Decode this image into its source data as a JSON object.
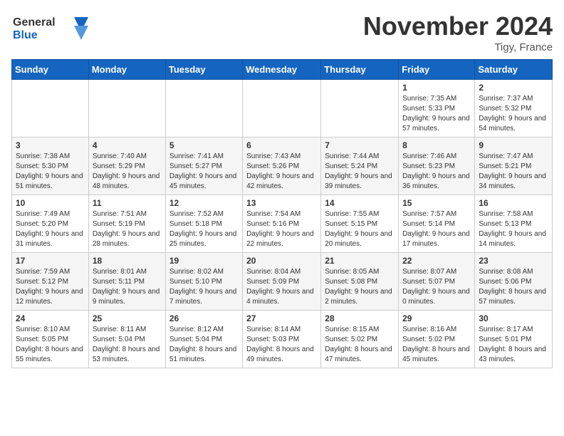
{
  "header": {
    "logo_line1": "General",
    "logo_line2": "Blue",
    "month_title": "November 2024",
    "location": "Tigy, France"
  },
  "weekdays": [
    "Sunday",
    "Monday",
    "Tuesday",
    "Wednesday",
    "Thursday",
    "Friday",
    "Saturday"
  ],
  "weeks": [
    [
      {
        "day": "",
        "info": ""
      },
      {
        "day": "",
        "info": ""
      },
      {
        "day": "",
        "info": ""
      },
      {
        "day": "",
        "info": ""
      },
      {
        "day": "",
        "info": ""
      },
      {
        "day": "1",
        "info": "Sunrise: 7:35 AM\nSunset: 5:33 PM\nDaylight: 9 hours and 57 minutes."
      },
      {
        "day": "2",
        "info": "Sunrise: 7:37 AM\nSunset: 5:32 PM\nDaylight: 9 hours and 54 minutes."
      }
    ],
    [
      {
        "day": "3",
        "info": "Sunrise: 7:38 AM\nSunset: 5:30 PM\nDaylight: 9 hours and 51 minutes."
      },
      {
        "day": "4",
        "info": "Sunrise: 7:40 AM\nSunset: 5:29 PM\nDaylight: 9 hours and 48 minutes."
      },
      {
        "day": "5",
        "info": "Sunrise: 7:41 AM\nSunset: 5:27 PM\nDaylight: 9 hours and 45 minutes."
      },
      {
        "day": "6",
        "info": "Sunrise: 7:43 AM\nSunset: 5:26 PM\nDaylight: 9 hours and 42 minutes."
      },
      {
        "day": "7",
        "info": "Sunrise: 7:44 AM\nSunset: 5:24 PM\nDaylight: 9 hours and 39 minutes."
      },
      {
        "day": "8",
        "info": "Sunrise: 7:46 AM\nSunset: 5:23 PM\nDaylight: 9 hours and 36 minutes."
      },
      {
        "day": "9",
        "info": "Sunrise: 7:47 AM\nSunset: 5:21 PM\nDaylight: 9 hours and 34 minutes."
      }
    ],
    [
      {
        "day": "10",
        "info": "Sunrise: 7:49 AM\nSunset: 5:20 PM\nDaylight: 9 hours and 31 minutes."
      },
      {
        "day": "11",
        "info": "Sunrise: 7:51 AM\nSunset: 5:19 PM\nDaylight: 9 hours and 28 minutes."
      },
      {
        "day": "12",
        "info": "Sunrise: 7:52 AM\nSunset: 5:18 PM\nDaylight: 9 hours and 25 minutes."
      },
      {
        "day": "13",
        "info": "Sunrise: 7:54 AM\nSunset: 5:16 PM\nDaylight: 9 hours and 22 minutes."
      },
      {
        "day": "14",
        "info": "Sunrise: 7:55 AM\nSunset: 5:15 PM\nDaylight: 9 hours and 20 minutes."
      },
      {
        "day": "15",
        "info": "Sunrise: 7:57 AM\nSunset: 5:14 PM\nDaylight: 9 hours and 17 minutes."
      },
      {
        "day": "16",
        "info": "Sunrise: 7:58 AM\nSunset: 5:13 PM\nDaylight: 9 hours and 14 minutes."
      }
    ],
    [
      {
        "day": "17",
        "info": "Sunrise: 7:59 AM\nSunset: 5:12 PM\nDaylight: 9 hours and 12 minutes."
      },
      {
        "day": "18",
        "info": "Sunrise: 8:01 AM\nSunset: 5:11 PM\nDaylight: 9 hours and 9 minutes."
      },
      {
        "day": "19",
        "info": "Sunrise: 8:02 AM\nSunset: 5:10 PM\nDaylight: 9 hours and 7 minutes."
      },
      {
        "day": "20",
        "info": "Sunrise: 8:04 AM\nSunset: 5:09 PM\nDaylight: 9 hours and 4 minutes."
      },
      {
        "day": "21",
        "info": "Sunrise: 8:05 AM\nSunset: 5:08 PM\nDaylight: 9 hours and 2 minutes."
      },
      {
        "day": "22",
        "info": "Sunrise: 8:07 AM\nSunset: 5:07 PM\nDaylight: 9 hours and 0 minutes."
      },
      {
        "day": "23",
        "info": "Sunrise: 8:08 AM\nSunset: 5:06 PM\nDaylight: 8 hours and 57 minutes."
      }
    ],
    [
      {
        "day": "24",
        "info": "Sunrise: 8:10 AM\nSunset: 5:05 PM\nDaylight: 8 hours and 55 minutes."
      },
      {
        "day": "25",
        "info": "Sunrise: 8:11 AM\nSunset: 5:04 PM\nDaylight: 8 hours and 53 minutes."
      },
      {
        "day": "26",
        "info": "Sunrise: 8:12 AM\nSunset: 5:04 PM\nDaylight: 8 hours and 51 minutes."
      },
      {
        "day": "27",
        "info": "Sunrise: 8:14 AM\nSunset: 5:03 PM\nDaylight: 8 hours and 49 minutes."
      },
      {
        "day": "28",
        "info": "Sunrise: 8:15 AM\nSunset: 5:02 PM\nDaylight: 8 hours and 47 minutes."
      },
      {
        "day": "29",
        "info": "Sunrise: 8:16 AM\nSunset: 5:02 PM\nDaylight: 8 hours and 45 minutes."
      },
      {
        "day": "30",
        "info": "Sunrise: 8:17 AM\nSunset: 5:01 PM\nDaylight: 8 hours and 43 minutes."
      }
    ]
  ]
}
